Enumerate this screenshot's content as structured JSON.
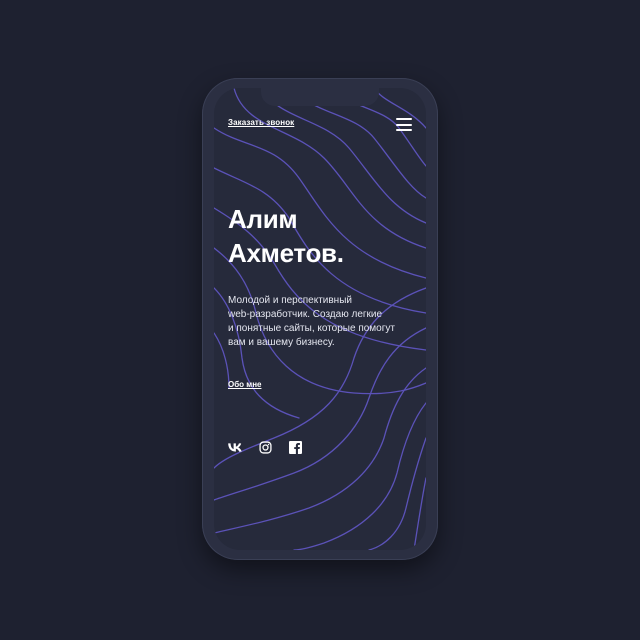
{
  "header": {
    "callback_label": "Заказать звонок"
  },
  "hero": {
    "name_line1": "Алим",
    "name_line2": "Ахметов.",
    "description_line1": "Молодой и перспективный",
    "description_line2": "web-разработчик. Создаю легкие",
    "description_line3": "и понятные сайты, которые помогут",
    "description_line4": "вам и вашему бизнесу.",
    "about_label": "Обо мне"
  },
  "socials": [
    {
      "icon": "vk-icon",
      "glyph": "vk"
    },
    {
      "icon": "instagram-icon"
    },
    {
      "icon": "facebook-icon",
      "glyph": "f"
    }
  ],
  "colors": {
    "background": "#1e2130",
    "screen": "#262a3b",
    "wave_lines": "#5b52b8",
    "text": "#ffffff"
  }
}
